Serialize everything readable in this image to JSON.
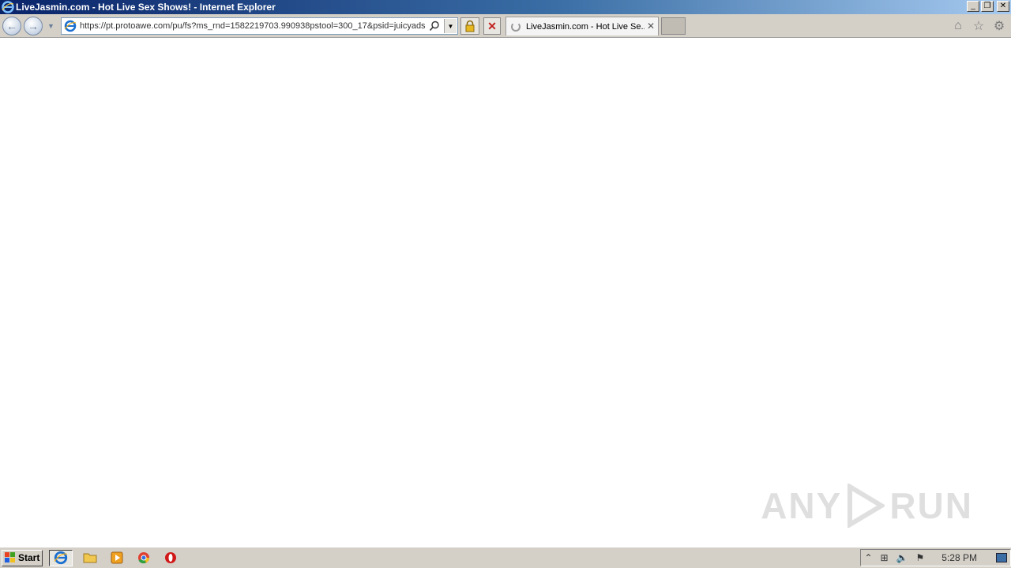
{
  "window": {
    "title": "LiveJasmin.com - Hot Live Sex Shows! - Internet Explorer",
    "buttons": {
      "minimize": "_",
      "restore": "❐",
      "close": "✕"
    }
  },
  "navbar": {
    "back_icon": "back-arrow-icon",
    "forward_icon": "forward-arrow-icon",
    "address_url": "https://pt.protoawe.com/pu/fs?ms_rnd=1582219703.990938pstool=300_17&psid=juicyads",
    "stop_label": "✕"
  },
  "tabs": [
    {
      "label": "LiveJasmin.com - Hot Live Se...",
      "close": "✕",
      "state": "loading"
    }
  ],
  "toolbar_right": {
    "home": "⌂",
    "favorites": "☆",
    "tools": "⚙"
  },
  "watermark": {
    "text_left": "ANY",
    "text_right": "RUN"
  },
  "taskbar": {
    "start_label": "Start",
    "apps": [
      "internet-explorer",
      "file-explorer",
      "media-player",
      "chrome",
      "opera"
    ],
    "tray": {
      "expand": "⌃",
      "network": "⊞",
      "volume": "🔈",
      "flag": "⚑"
    },
    "clock": "5:28 PM"
  },
  "colors": {
    "title_gradient_start": "#0a246a",
    "chrome": "#d4d0c8",
    "stop_red": "#c02020"
  }
}
